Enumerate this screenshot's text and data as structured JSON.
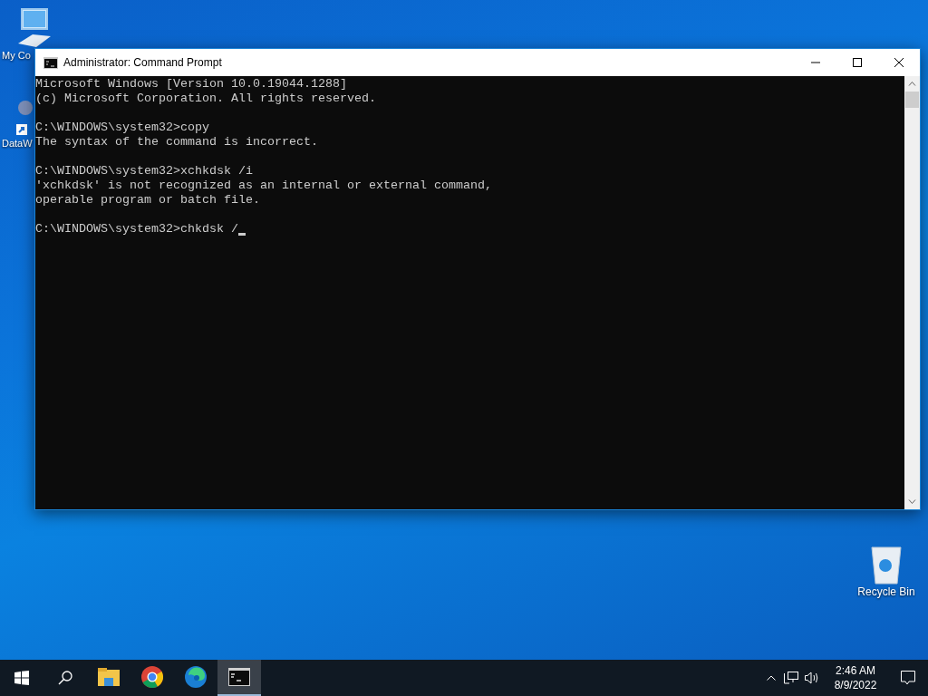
{
  "desktop_icons": [
    {
      "label": "My Co",
      "kind": "computer"
    },
    {
      "label": "DataW",
      "kind": "shortcut"
    },
    {
      "label": "Recycle Bin",
      "kind": "recycle"
    }
  ],
  "window": {
    "title": "Administrator: Command Prompt"
  },
  "console": {
    "blocks": [
      [
        "Microsoft Windows [Version 10.0.19044.1288]",
        "(c) Microsoft Corporation. All rights reserved."
      ],
      [
        "C:\\WINDOWS\\system32>copy",
        "The syntax of the command is incorrect."
      ],
      [
        "C:\\WINDOWS\\system32>xchkdsk /i",
        "'xchkdsk' is not recognized as an internal or external command,",
        "operable program or batch file."
      ],
      [
        "C:\\WINDOWS\\system32>chkdsk /"
      ]
    ],
    "cursor": true
  },
  "taskbar": {
    "apps": [
      {
        "kind": "explorer",
        "selected": false
      },
      {
        "kind": "chrome",
        "selected": false
      },
      {
        "kind": "edge",
        "selected": false
      },
      {
        "kind": "cmd",
        "selected": true
      }
    ],
    "time": "2:46 AM",
    "date": "8/9/2022"
  }
}
